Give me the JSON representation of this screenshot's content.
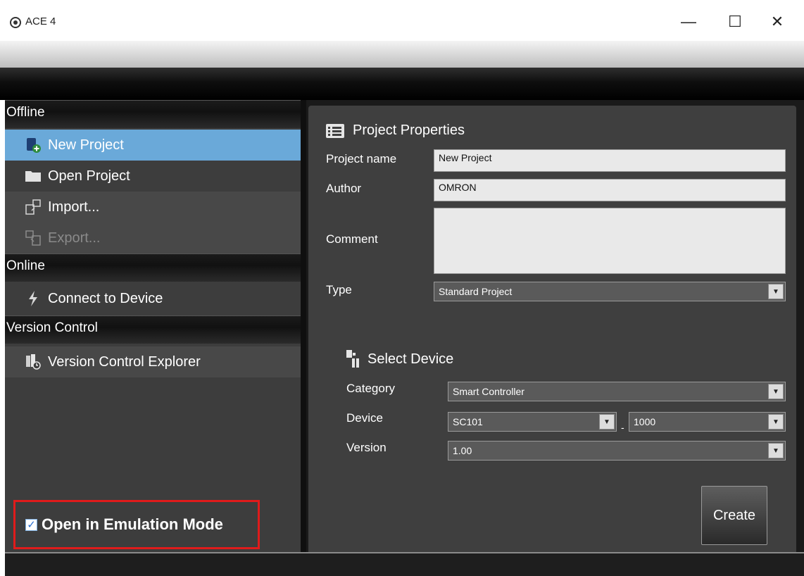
{
  "window": {
    "title": "ACE 4",
    "minimize_glyph": "—",
    "maximize_glyph": "☐",
    "close_glyph": "✕"
  },
  "sidebar": {
    "sections": [
      {
        "header": "Offline"
      },
      {
        "header": "Online"
      },
      {
        "header": "Version Control"
      }
    ],
    "items": [
      {
        "label": "New Project",
        "icon": "new-project-icon",
        "selected": true
      },
      {
        "label": "Open Project",
        "icon": "folder-icon"
      },
      {
        "label": "Import...",
        "icon": "import-icon"
      },
      {
        "label": "Export...",
        "icon": "export-icon",
        "disabled": true
      },
      {
        "label": "Connect to Device",
        "icon": "lightning-icon"
      },
      {
        "label": "Version Control Explorer",
        "icon": "version-control-icon"
      }
    ],
    "emulation": {
      "label": "Open in Emulation Mode",
      "checked": true,
      "check_glyph": "✓"
    }
  },
  "properties": {
    "title": "Project Properties",
    "project_name_label": "Project name",
    "project_name_value": "New Project",
    "author_label": "Author",
    "author_value": "OMRON",
    "comment_label": "Comment",
    "comment_value": "",
    "type_label": "Type",
    "type_value": "Standard Project"
  },
  "device": {
    "title": "Select Device",
    "category_label": "Category",
    "category_value": "Smart Controller",
    "device_label": "Device",
    "device_value": "SC101",
    "device_separator": "-",
    "device_model_value": "1000",
    "version_label": "Version",
    "version_value": "1.00"
  },
  "actions": {
    "create_label": "Create"
  },
  "colors": {
    "selection": "#6aa9d9",
    "highlight_border": "#e01b1b",
    "sidebar_bg": "#3d3d3d",
    "panel_bg": "#3f3f3f"
  }
}
